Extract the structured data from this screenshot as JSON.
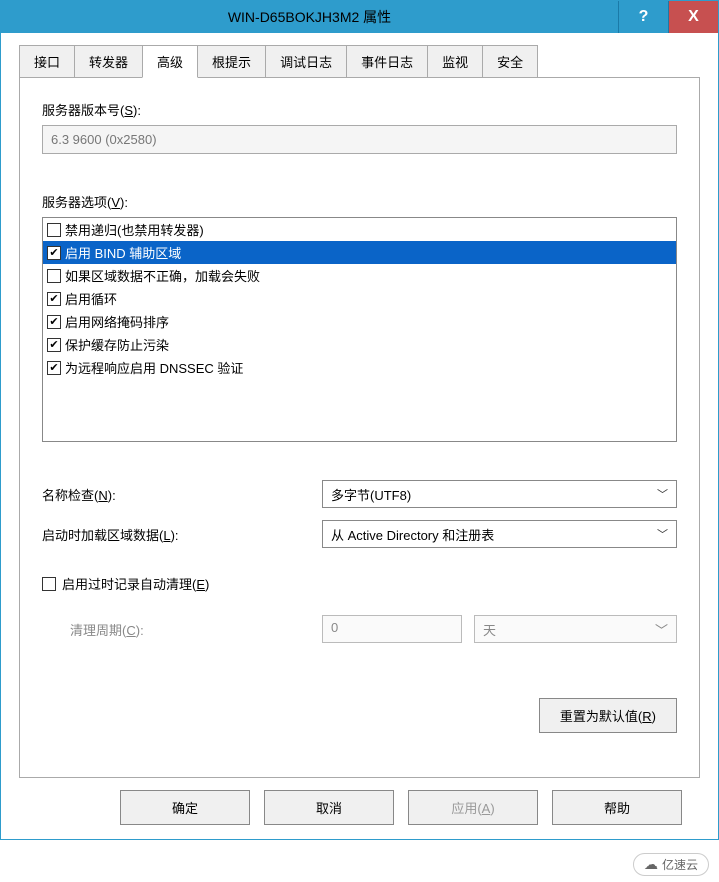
{
  "title": "WIN-D65BOKJH3M2 属性",
  "titlebar": {
    "help": "?",
    "close": "X"
  },
  "tabs": [
    "接口",
    "转发器",
    "高级",
    "根提示",
    "调试日志",
    "事件日志",
    "监视",
    "安全"
  ],
  "active_tab": 2,
  "server_version": {
    "label_pre": "服务器版本号(",
    "label_key": "S",
    "label_post": "):",
    "value": "6.3 9600 (0x2580)"
  },
  "server_options": {
    "label_pre": "服务器选项(",
    "label_key": "V",
    "label_post": "):",
    "items": [
      {
        "checked": false,
        "selected": false,
        "text": "禁用递归(也禁用转发器)"
      },
      {
        "checked": true,
        "selected": true,
        "text": "启用 BIND 辅助区域"
      },
      {
        "checked": false,
        "selected": false,
        "text": "如果区域数据不正确，加载会失败"
      },
      {
        "checked": true,
        "selected": false,
        "text": "启用循环"
      },
      {
        "checked": true,
        "selected": false,
        "text": "启用网络掩码排序"
      },
      {
        "checked": true,
        "selected": false,
        "text": "保护缓存防止污染"
      },
      {
        "checked": true,
        "selected": false,
        "text": "为远程响应启用 DNSSEC 验证"
      }
    ]
  },
  "name_check": {
    "label_pre": "名称检查(",
    "label_key": "N",
    "label_post": "):",
    "value": "多字节(UTF8)"
  },
  "load_zone": {
    "label_pre": "启动时加载区域数据(",
    "label_key": "L",
    "label_post": "):",
    "value": "从 Active Directory 和注册表"
  },
  "scavenging": {
    "enable_pre": "启用过时记录自动清理(",
    "enable_key": "E",
    "enable_post": ")",
    "enable_checked": false,
    "period_pre": "清理周期(",
    "period_key": "C",
    "period_post": "):",
    "period_value": "0",
    "period_unit": "天"
  },
  "reset_btn": {
    "pre": "重置为默认值(",
    "key": "R",
    "post": ")"
  },
  "buttons": {
    "ok": "确定",
    "cancel": "取消",
    "apply_pre": "应用(",
    "apply_key": "A",
    "apply_post": ")",
    "help": "帮助"
  },
  "watermark": "亿速云"
}
